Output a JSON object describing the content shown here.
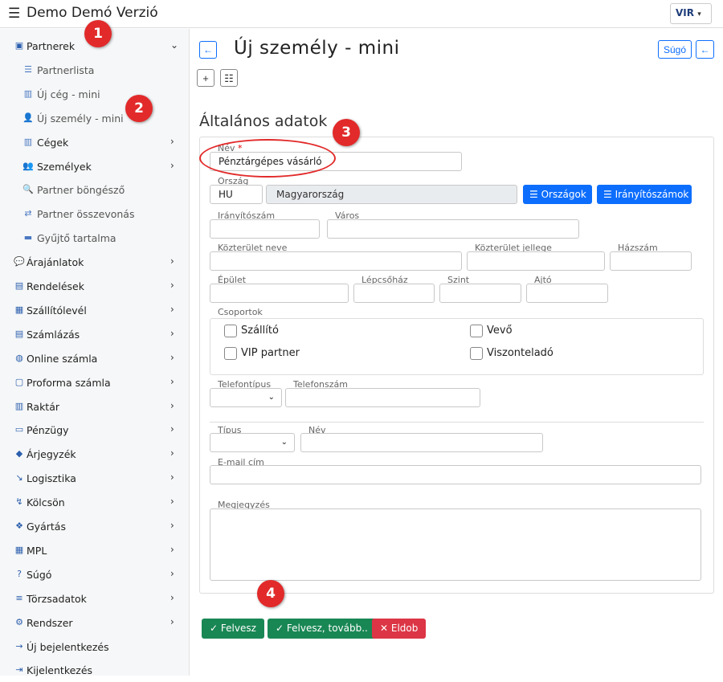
{
  "app": {
    "title": "Demo Demó Verzió",
    "logo_text": "VIR"
  },
  "sidebar": {
    "items": [
      {
        "label": "Partnerek",
        "icon": "address-card-icon",
        "chevron": "⌄",
        "type": "main"
      },
      {
        "label": "Partnerlista",
        "icon": "list-icon",
        "type": "sub"
      },
      {
        "label": "Új cég - mini",
        "icon": "building-icon",
        "type": "sub"
      },
      {
        "label": "Új személy - mini",
        "icon": "user-plus-icon",
        "type": "sub"
      },
      {
        "label": "Cégek",
        "icon": "building-icon",
        "chevron": "›",
        "type": "sub"
      },
      {
        "label": "Személyek",
        "icon": "users-icon",
        "chevron": "›",
        "type": "sub"
      },
      {
        "label": "Partner böngésző",
        "icon": "search-icon",
        "type": "sub"
      },
      {
        "label": "Partner összevonás",
        "icon": "handshake-icon",
        "type": "sub"
      },
      {
        "label": "Gyűjtő tartalma",
        "icon": "archive-icon",
        "type": "sub"
      },
      {
        "label": "Árajánlatok",
        "icon": "comments-icon",
        "chevron": "›",
        "type": "main"
      },
      {
        "label": "Rendelések",
        "icon": "file-icon",
        "chevron": "›",
        "type": "main"
      },
      {
        "label": "Szállítólevél",
        "icon": "clipboard-icon",
        "chevron": "›",
        "type": "main"
      },
      {
        "label": "Számlázás",
        "icon": "file-invoice-icon",
        "chevron": "›",
        "type": "main"
      },
      {
        "label": "Online számla",
        "icon": "globe-icon",
        "chevron": "›",
        "type": "main"
      },
      {
        "label": "Proforma számla",
        "icon": "sticky-note-icon",
        "chevron": "›",
        "type": "main"
      },
      {
        "label": "Raktár",
        "icon": "warehouse-icon",
        "chevron": "›",
        "type": "main"
      },
      {
        "label": "Pénzügy",
        "icon": "money-icon",
        "chevron": "›",
        "type": "main"
      },
      {
        "label": "Árjegyzék",
        "icon": "tags-icon",
        "chevron": "›",
        "type": "main"
      },
      {
        "label": "Logisztika",
        "icon": "dolly-icon",
        "chevron": "›",
        "type": "main"
      },
      {
        "label": "Kölcsön",
        "icon": "hand-holding-icon",
        "chevron": "›",
        "type": "main"
      },
      {
        "label": "Gyártás",
        "icon": "cubes-icon",
        "chevron": "›",
        "type": "main"
      },
      {
        "label": "MPL",
        "icon": "pallet-icon",
        "chevron": "›",
        "type": "main"
      },
      {
        "label": "Súgó",
        "icon": "question-circle-icon",
        "chevron": "›",
        "type": "main"
      },
      {
        "label": "Törzsadatok",
        "icon": "database-icon",
        "chevron": "›",
        "type": "main"
      },
      {
        "label": "Rendszer",
        "icon": "cogs-icon",
        "chevron": "›",
        "type": "main"
      },
      {
        "label": "Új bejelentkezés",
        "icon": "sign-in-icon",
        "type": "main"
      },
      {
        "label": "Kijelentkezés",
        "icon": "sign-out-icon",
        "type": "main"
      }
    ]
  },
  "header": {
    "page_title": "Új személy - mini",
    "help_label": "Súgó"
  },
  "form": {
    "section_title": "Általános adatok",
    "name_label": "Név",
    "name_required": "*",
    "name_value": "Pénztárgépes vásárló",
    "country_label": "Ország",
    "country_code": "HU",
    "country_name": "Magyarország",
    "countries_button": "Országok",
    "zip_button": "Irányítószámok",
    "zip_label": "Irányítószám",
    "city_label": "Város",
    "street_label": "Közterület neve",
    "street_type_label": "Közterület jellege",
    "house_label": "Házszám",
    "building_label": "Épület",
    "stair_label": "Lépcsőház",
    "floor_label": "Szint",
    "door_label": "Ajtó",
    "groups_label": "Csoportok",
    "groups": {
      "supplier": "Szállító",
      "buyer": "Vevő",
      "vip": "VIP partner",
      "reseller": "Viszonteladó"
    },
    "phone_type_label": "Telefontípus",
    "phone_number_label": "Telefonszám",
    "type_label": "Típus",
    "contact_name_label": "Név",
    "email_label": "E-mail cím",
    "note_label": "Megjegyzés"
  },
  "actions": {
    "add": "Felvesz",
    "add_more": "Felvesz, tovább..",
    "discard": "Eldob"
  },
  "markers": [
    "1",
    "2",
    "3",
    "4"
  ],
  "colors": {
    "primary": "#0d6efd",
    "success": "#198754",
    "danger": "#dc3545",
    "marker": "#e22a2a"
  }
}
